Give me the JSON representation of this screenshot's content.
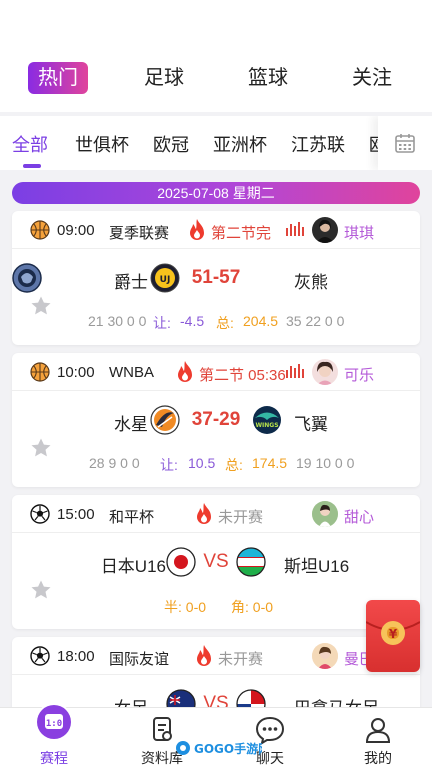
{
  "top_tabs": [
    "热门",
    "足球",
    "篮球",
    "关注"
  ],
  "categories": [
    "全部",
    "世俱杯",
    "欧冠",
    "亚洲杯",
    "江苏联",
    "欧"
  ],
  "date_banner": "2025-07-08 星期二",
  "matches": [
    {
      "sport": "basketball",
      "time": "09:00",
      "league": "夏季联赛",
      "status": "第二节完",
      "host": "琪琪",
      "home": "爵士",
      "away": "灰熊",
      "center": "51-57",
      "odds": [
        "21 30 0 0",
        "让:",
        "-4.5",
        "总:",
        "204.5",
        "35 22 0 0"
      ]
    },
    {
      "sport": "basketball",
      "time": "10:00",
      "league": "WNBA",
      "status": "第二节 05:36",
      "host": "可乐",
      "home": "水星",
      "away": "飞翼",
      "center": "37-29",
      "odds": [
        "28 9 0 0",
        "让:",
        "10.5",
        "总:",
        "174.5",
        "19 10 0 0"
      ]
    },
    {
      "sport": "football",
      "time": "15:00",
      "league": "和平杯",
      "status": "未开赛",
      "host": "甜心",
      "home": "日本U16",
      "away": "斯坦U16",
      "center": "VS",
      "odds": [
        "半: 0-0",
        "角: 0-0"
      ]
    },
    {
      "sport": "football",
      "time": "18:00",
      "league": "国际友谊",
      "status": "未开赛",
      "host": "曼巴",
      "home": "女足",
      "away": "巴拿马女足",
      "center": "VS",
      "odds": []
    }
  ],
  "bottom_nav": [
    "赛程",
    "资料库",
    "聊天",
    "我的"
  ],
  "watermark": "GOGO手游网",
  "colors": {
    "accent": "#7b3fe4",
    "live_red": "#e0443a",
    "host_pink": "#b45ad8",
    "odds_orange": "#f0a020"
  }
}
